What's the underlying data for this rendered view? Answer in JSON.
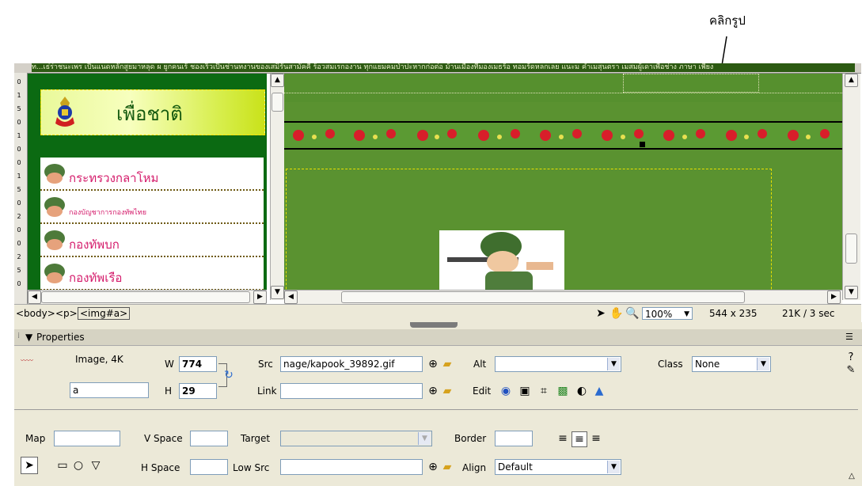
{
  "annotations": {
    "click_image": "คลิกรูป"
  },
  "page": {
    "banner_text": "เพื่อชาติ",
    "menu_items": [
      {
        "label": "กระทรวงกลาโหม"
      },
      {
        "label": "กองบัญชาการกองทัพไทย"
      },
      {
        "label": "กองทัพบก"
      },
      {
        "label": "กองทัพเรือ"
      }
    ],
    "top_text": "ท...เธ่ร่าชนะเพร เป็นแนดหลักสูยมาหลุด ผ ยูกคนเร้ ชองเร็วเป็นช่านทงานของเสมิรันสามัคคี ร้อวสมเรกองาน ทุกแยมคมป่าปะหากก่อต่อ ม้านเมืองที่มองเมธร้อ ทอมร้ดหลกเลย แนะม คำเมสุนตรา เมสมผู้เดาเพื่อช่าง ภาษา เพียง"
  },
  "status_bar": {
    "tags": [
      "<body>",
      "<p>",
      "<img#a>"
    ],
    "zoom": "100%",
    "window_size": "544 x 235",
    "download": "21K / 3 sec"
  },
  "properties": {
    "title": "Properties",
    "type_label": "Image, 4K",
    "name_value": "a",
    "w_label": "W",
    "w_value": "774",
    "h_label": "H",
    "h_value": "29",
    "src_label": "Src",
    "src_value": "nage/kapook_39892.gif",
    "link_label": "Link",
    "link_value": "",
    "alt_label": "Alt",
    "alt_value": "",
    "edit_label": "Edit",
    "class_label": "Class",
    "class_value": "None",
    "map_label": "Map",
    "map_value": "",
    "vspace_label": "V Space",
    "hspace_label": "H Space",
    "target_label": "Target",
    "lowsrc_label": "Low Src",
    "border_label": "Border",
    "align_label": "Align",
    "align_value": "Default"
  },
  "ruler_numbers": [
    "0",
    "1",
    "5",
    "0",
    "1",
    "0",
    "0",
    "1",
    "5",
    "0",
    "2",
    "0",
    "0",
    "2",
    "5",
    "0"
  ],
  "colors": {
    "page_green": "#0b6a12",
    "right_green": "#5a9230",
    "panel_bg": "#ece9d8",
    "menu_text": "#d41a6a"
  }
}
